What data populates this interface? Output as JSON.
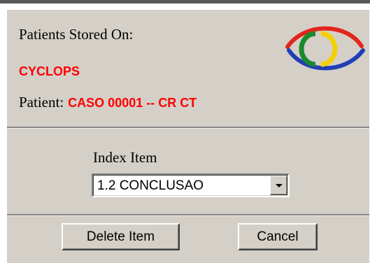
{
  "header": {
    "stored_label": "Patients Stored On:",
    "server_name": "CYCLOPS",
    "patient_label": "Patient:",
    "patient_value": "CASO 00001 -- CR CT"
  },
  "logo": {
    "icon": "eye-logo-icon",
    "colors": {
      "upper_arc": "#e1261c",
      "lower_arc": "#1f3fb4",
      "iris_left": "#1a8a2c",
      "iris_right": "#f4d000"
    }
  },
  "index": {
    "label": "Index Item",
    "selected": "1.2 CONCLUSAO"
  },
  "actions": {
    "delete_label": "Delete Item",
    "cancel_label": "Cancel"
  },
  "colors": {
    "panel": "#d4d0c8",
    "accent_text": "#ff0000"
  }
}
